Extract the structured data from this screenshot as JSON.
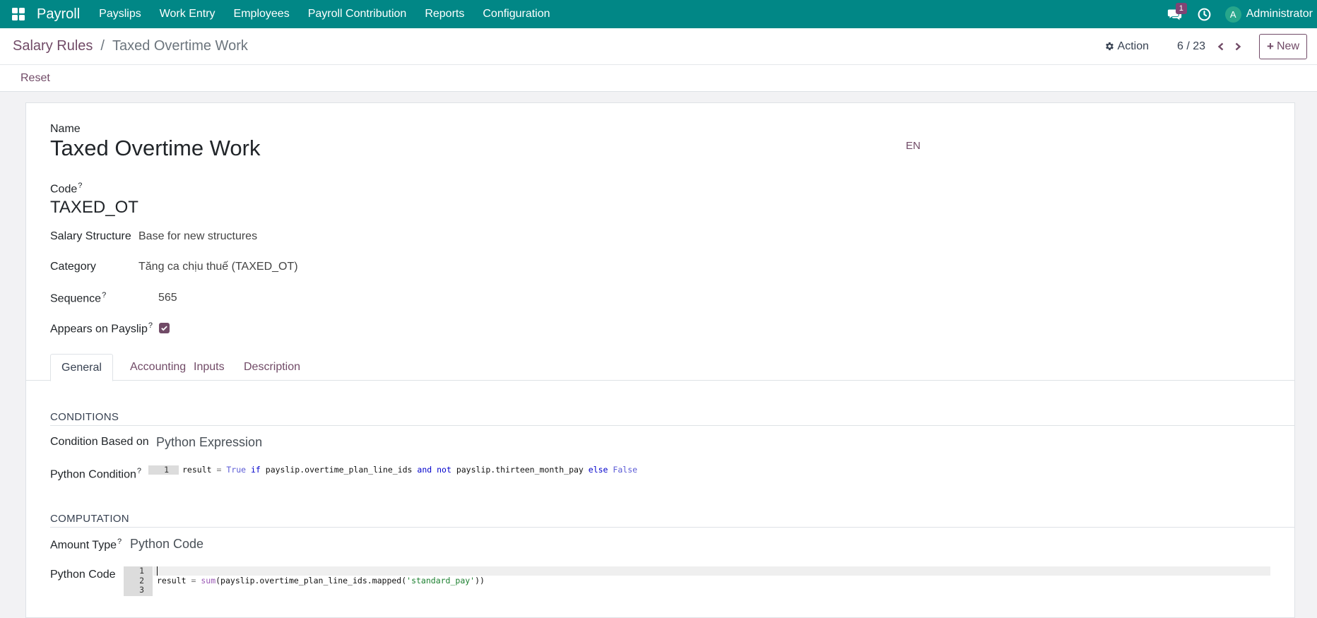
{
  "navbar": {
    "brand": "Payroll",
    "menu": [
      "Payslips",
      "Work Entry",
      "Employees",
      "Payroll Contribution",
      "Reports",
      "Configuration"
    ],
    "message_count": "1",
    "user_initial": "A",
    "user_name": "Administrator"
  },
  "control": {
    "breadcrumb_parent": "Salary Rules",
    "breadcrumb_separator": "/",
    "breadcrumb_current": "Taxed Overtime Work",
    "action_label": "Action",
    "pager": "6 / 23",
    "new_label": "New"
  },
  "statusbar": {
    "reset_label": "Reset"
  },
  "form": {
    "name_label": "Name",
    "name_value": "Taxed Overtime Work",
    "lang": "EN",
    "code_label": "Code",
    "code_value": "TAXED_OT",
    "structure_label": "Salary Structure",
    "structure_value": "Base for new structures",
    "category_label": "Category",
    "category_value": "Tăng ca chịu thuế (TAXED_OT)",
    "sequence_label": "Sequence",
    "sequence_value": "565",
    "appears_label": "Appears on Payslip",
    "appears_checked": true,
    "help_mark": "?"
  },
  "tabs": [
    "General",
    "Accounting",
    "Inputs",
    "Description"
  ],
  "conditions": {
    "title": "CONDITIONS",
    "based_on_label": "Condition Based on",
    "based_on_value": "Python Expression",
    "python_condition_label": "Python Condition",
    "line_number": "1"
  },
  "computation": {
    "title": "COMPUTATION",
    "amount_type_label": "Amount Type",
    "amount_type_value": "Python Code",
    "python_code_label": "Python Code",
    "line_numbers": [
      "1",
      "2",
      "3"
    ]
  },
  "colors": {
    "navbar": "#018786",
    "accent": "#714b67"
  }
}
